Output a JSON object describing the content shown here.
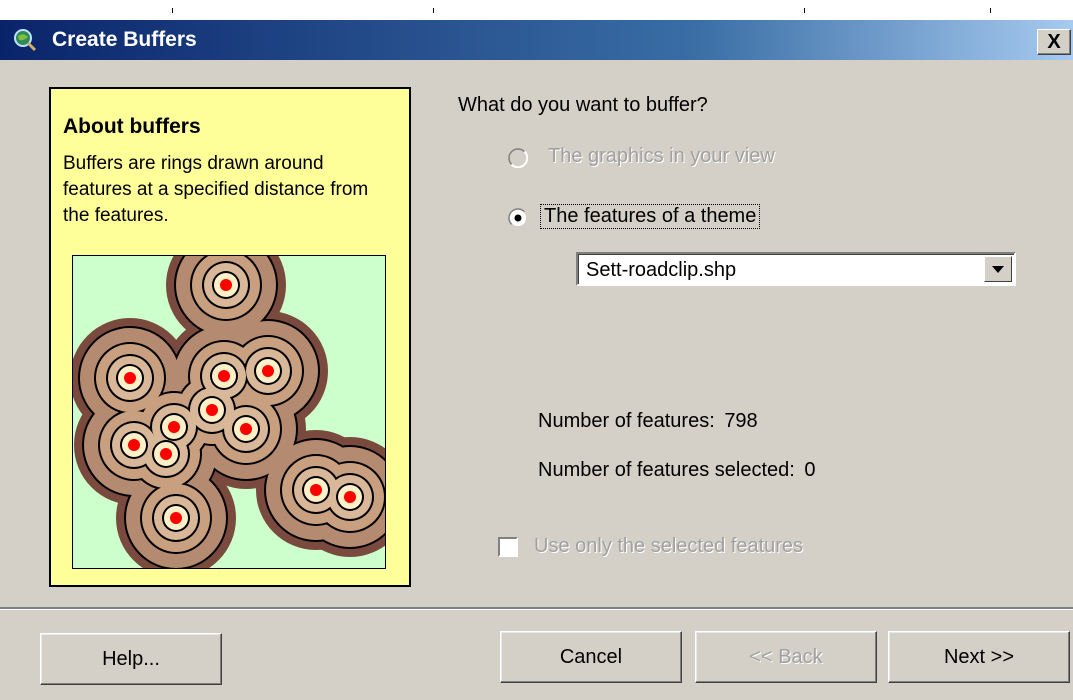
{
  "window": {
    "title": "Create Buffers",
    "close_label": "X"
  },
  "about": {
    "heading": "About buffers",
    "body": "Buffers are rings drawn around features at a specified distance from the features."
  },
  "form": {
    "question": "What do you want to buffer?",
    "option_graphics": "The graphics in your view",
    "option_features": "The features of a theme",
    "selected_option": "features",
    "theme_select_value": "Sett-roadclip.shp",
    "features_label": "Number of features:",
    "features_count": "798",
    "selected_label": "Number of features selected:",
    "selected_count": "0",
    "use_selected_label": "Use only the selected features",
    "use_selected_checked": false
  },
  "buttons": {
    "help": "Help...",
    "cancel": "Cancel",
    "back": "<< Back",
    "next": "Next >>"
  },
  "colors": {
    "about_bg": "#ffff99",
    "illus_bg": "#ccffcc",
    "ring_dark": "#7b4a3e",
    "ring_mid": "#b48a70",
    "ring_light": "#fff0c8",
    "point": "#ff0000"
  },
  "icons": {
    "title": "globe-magnifier-icon"
  }
}
